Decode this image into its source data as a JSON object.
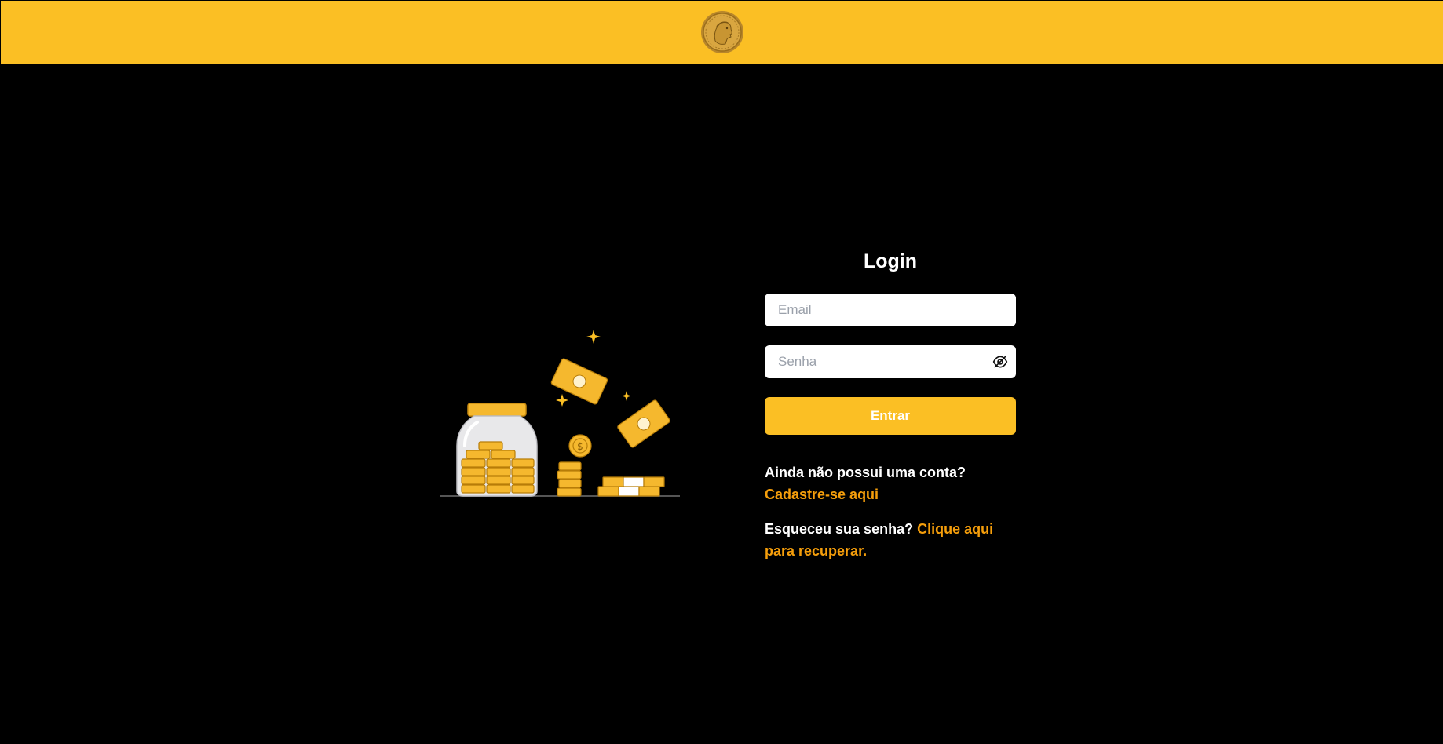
{
  "header": {
    "logo_icon": "gold-coin-profile-logo",
    "background_color": "#fbbf24"
  },
  "illustration": {
    "icon": "savings-coins-jar-illustration"
  },
  "login": {
    "title": "Login",
    "email_placeholder": "Email",
    "email_value": "",
    "password_placeholder": "Senha",
    "password_value": "",
    "password_toggle_icon": "eye-off-icon",
    "submit_label": "Entrar",
    "signup_prompt": "Ainda não possui uma conta?",
    "signup_link": "Cadastre-se aqui",
    "recover_prompt": "Esqueceu sua senha?",
    "recover_link": "Clique aqui para recuperar."
  },
  "colors": {
    "accent": "#fbbf24",
    "link": "#f59e0b",
    "background": "#000000"
  }
}
